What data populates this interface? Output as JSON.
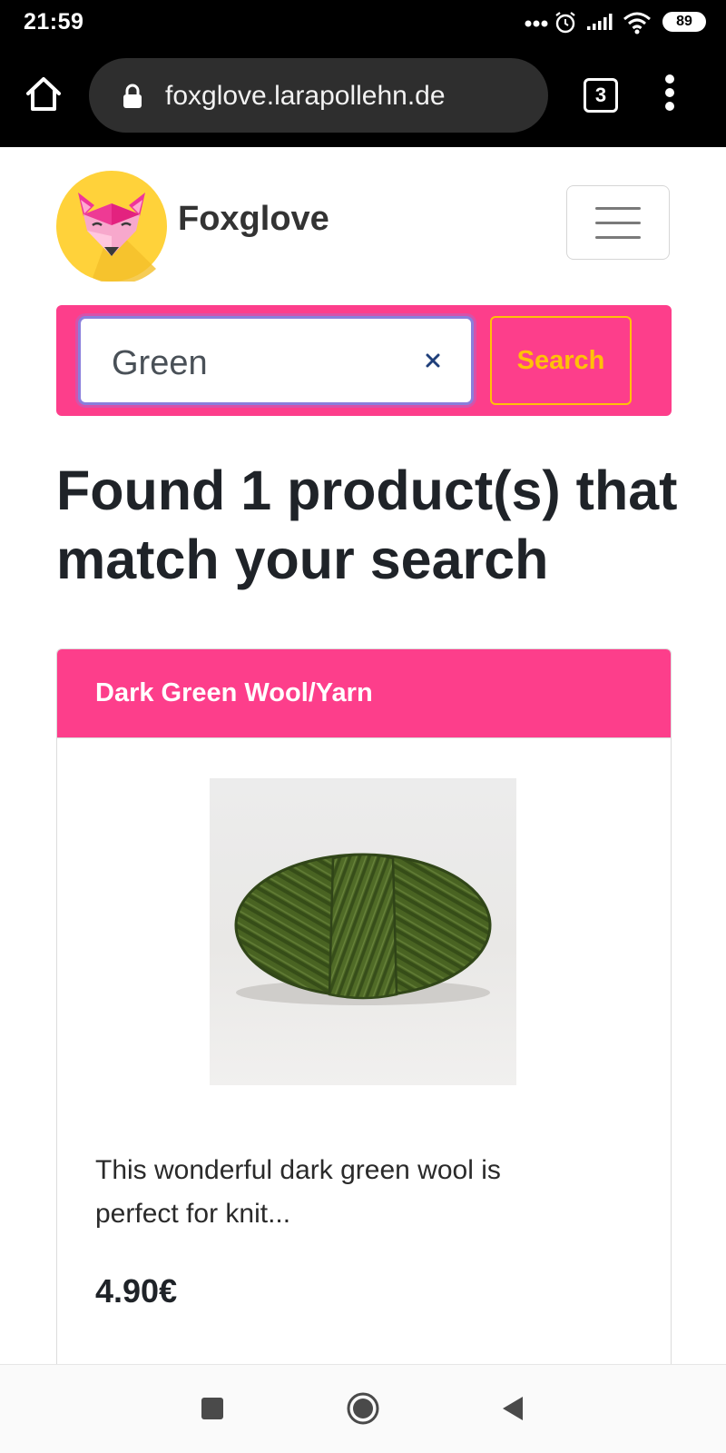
{
  "status_bar": {
    "time": "21:59",
    "battery": "89",
    "icons": [
      "dots-icon",
      "alarm-icon",
      "signal-icon",
      "wifi-icon",
      "battery-icon"
    ]
  },
  "browser": {
    "url": "foxglove.larapollehn.de",
    "tab_count": "3",
    "icons": [
      "home-icon",
      "lock-icon",
      "tabs-icon",
      "menu-dots-icon"
    ]
  },
  "site": {
    "brand_name": "Foxglove",
    "logo": "fox-logo",
    "menu_icon": "hamburger-icon"
  },
  "search": {
    "value": "Green",
    "button_label": "Search",
    "clear_icon": "close-icon"
  },
  "results": {
    "heading": "Found 1 product(s) that match your search"
  },
  "products": [
    {
      "title": "Dark Green Wool/Yarn",
      "description": "This wonderful dark green wool is perfect for knit...",
      "price": "4.90€",
      "image": "green-yarn-ball"
    }
  ],
  "system_nav": {
    "icons": [
      "recents-icon",
      "home-circle-icon",
      "back-icon"
    ]
  },
  "colors": {
    "accent_pink": "#fd3e8b",
    "warning_yellow": "#ffc107",
    "logo_yellow": "#ffd23a",
    "text_dark": "#212529"
  }
}
